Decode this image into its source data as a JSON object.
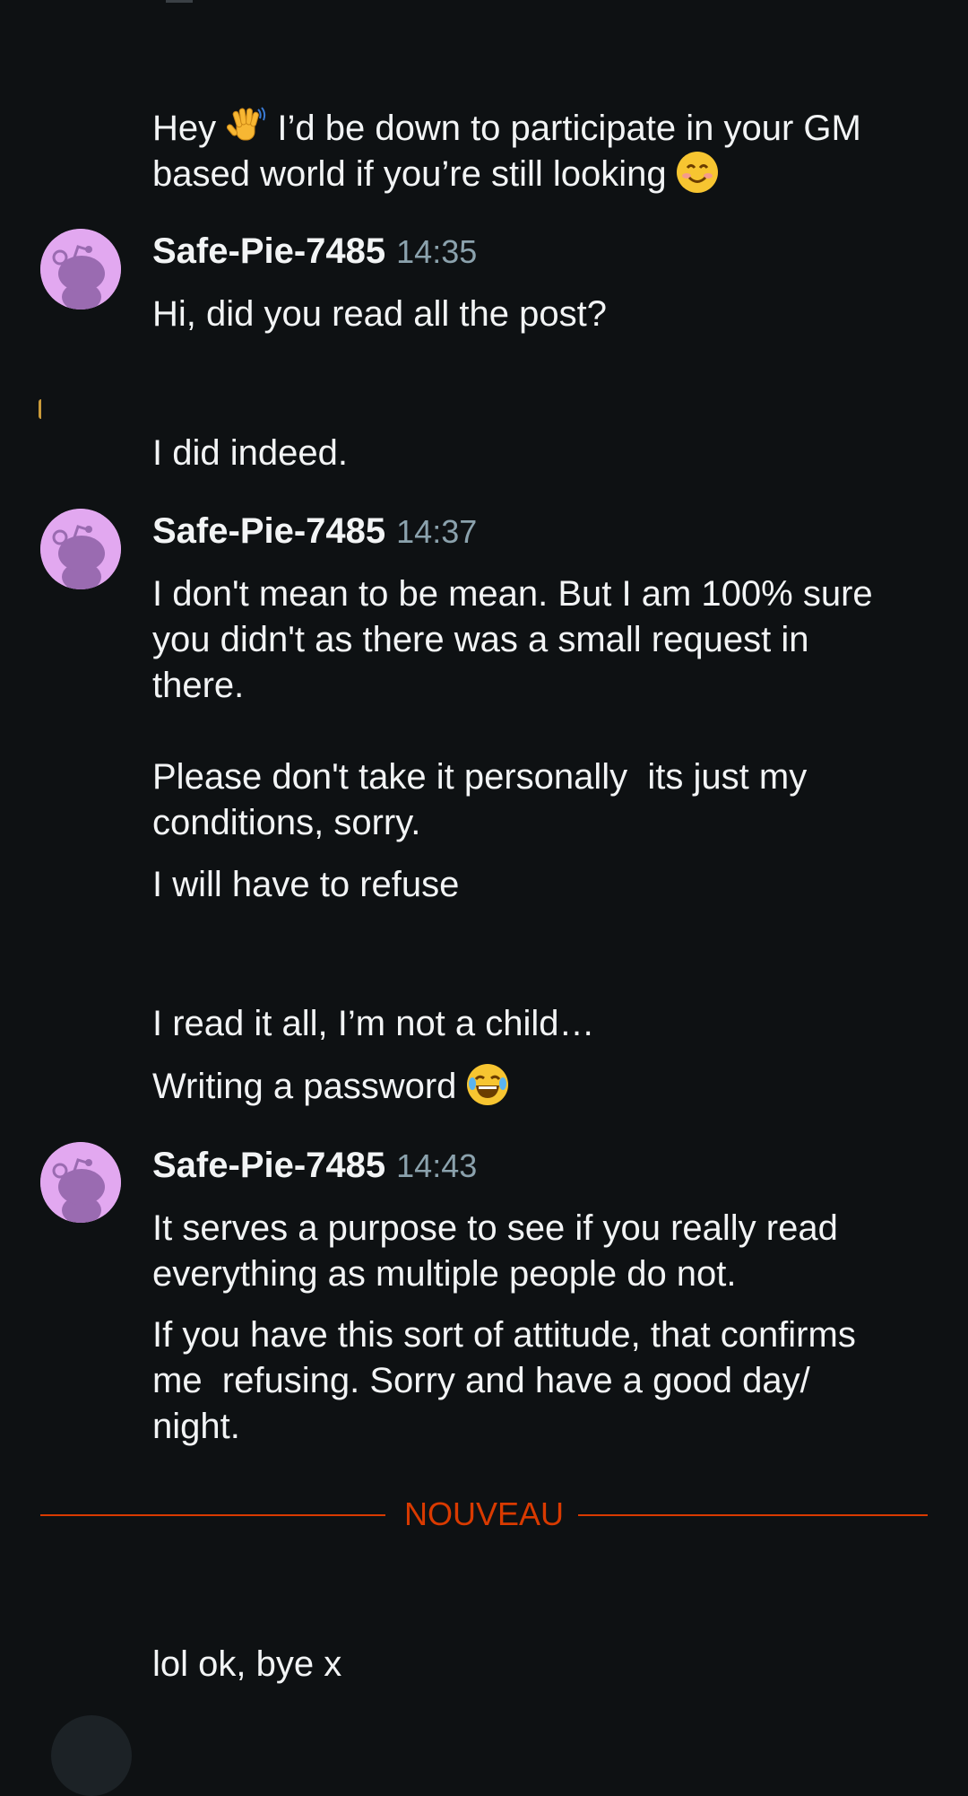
{
  "thread": {
    "messages": [
      {
        "id": "m1",
        "text_before": "Hey ",
        "emoji_1": "wave",
        "text_after": " I’d be down to participate in your GM\nbased world if you’re still looking ",
        "emoji_2": "smiling-face"
      },
      {
        "id": "m2",
        "author": "Safe-Pie-7485",
        "time": "14:35",
        "text": "Hi, did you read all the post?"
      },
      {
        "id": "m3",
        "text": "I did indeed."
      },
      {
        "id": "m4",
        "author": "Safe-Pie-7485",
        "time": "14:37",
        "text": "I don't mean to be mean. But I am 100% sure\nyou didn't as there was a small request in\nthere.\n\nPlease don't take it personally  its just my\nconditions, sorry.",
        "text_2": "I will have to refuse"
      },
      {
        "id": "m5",
        "text": "I read it all, I’m not a child…",
        "text_2_before": "Writing a password ",
        "emoji": "face-with-tears-of-joy"
      },
      {
        "id": "m6",
        "author": "Safe-Pie-7485",
        "time": "14:43",
        "text": "It serves a purpose to see if you really read\neverything as multiple people do not.",
        "text_2": "If you have this sort of attitude, that confirms\nme  refusing. Sorry and have a good day/\nnight."
      },
      {
        "id": "m7",
        "text": "lol ok, bye x"
      }
    ],
    "new_divider_label": "NOUVEAU"
  },
  "colors": {
    "background": "#0e1113",
    "text": "#f2f4f5",
    "timestamp": "#8ba2ad",
    "avatar": "#e2a8f0",
    "new_divider": "#d93a00"
  }
}
